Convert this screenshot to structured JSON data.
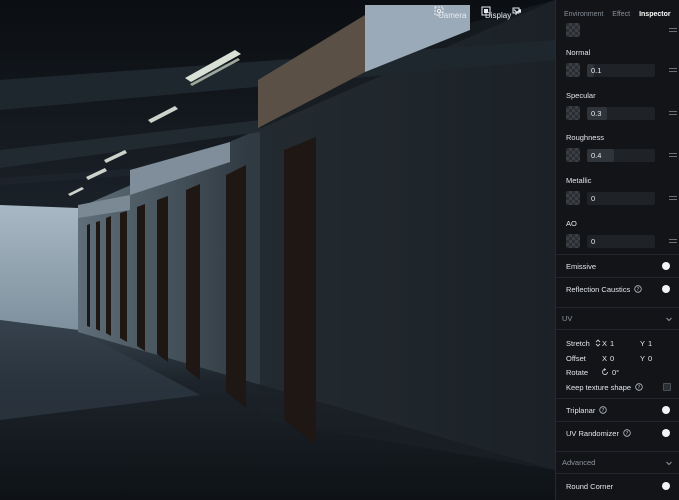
{
  "viewport": {
    "camera_label": "Camera",
    "display_label": "Display",
    "icons": [
      "camera-icon",
      "display-icon",
      "camera-settings-icon",
      "chevron-down-icon"
    ]
  },
  "panel": {
    "tabs": [
      {
        "label": "Environment",
        "active": false
      },
      {
        "label": "Effect",
        "active": false
      },
      {
        "label": "Inspector",
        "active": true
      }
    ],
    "material": {
      "normal": {
        "label": "Normal",
        "value": "0.1",
        "fill": 0.1
      },
      "specular": {
        "label": "Specular",
        "value": "0.3",
        "fill": 0.3
      },
      "roughness": {
        "label": "Roughness",
        "value": "0.4",
        "fill": 0.4
      },
      "metallic": {
        "label": "Metallic",
        "value": "0",
        "fill": 0
      },
      "ao": {
        "label": "AO",
        "value": "0",
        "fill": 0
      },
      "emissive": {
        "label": "Emissive",
        "on": false
      },
      "reflection_caustics": {
        "label": "Reflection Caustics",
        "on": false
      }
    },
    "uv": {
      "section_label": "UV",
      "stretch": {
        "label": "Stretch",
        "x_label": "X",
        "x": "1",
        "y_label": "Y",
        "y": "1"
      },
      "offset": {
        "label": "Offset",
        "x_label": "X",
        "x": "0",
        "y_label": "Y",
        "y": "0"
      },
      "rotate": {
        "label": "Rotate",
        "value": "0°"
      },
      "keep_texture_shape": {
        "label": "Keep texture shape",
        "checked": false
      },
      "triplanar": {
        "label": "Triplanar",
        "on": false
      },
      "uv_randomizer": {
        "label": "UV Randomizer",
        "on": false
      }
    },
    "advanced": {
      "section_label": "Advanced",
      "round_corner": {
        "label": "Round Corner",
        "on": false
      }
    }
  },
  "colors": {
    "panel_bg": "#121418",
    "accent_white": "#ffffff",
    "field_bg": "#1f2227"
  }
}
